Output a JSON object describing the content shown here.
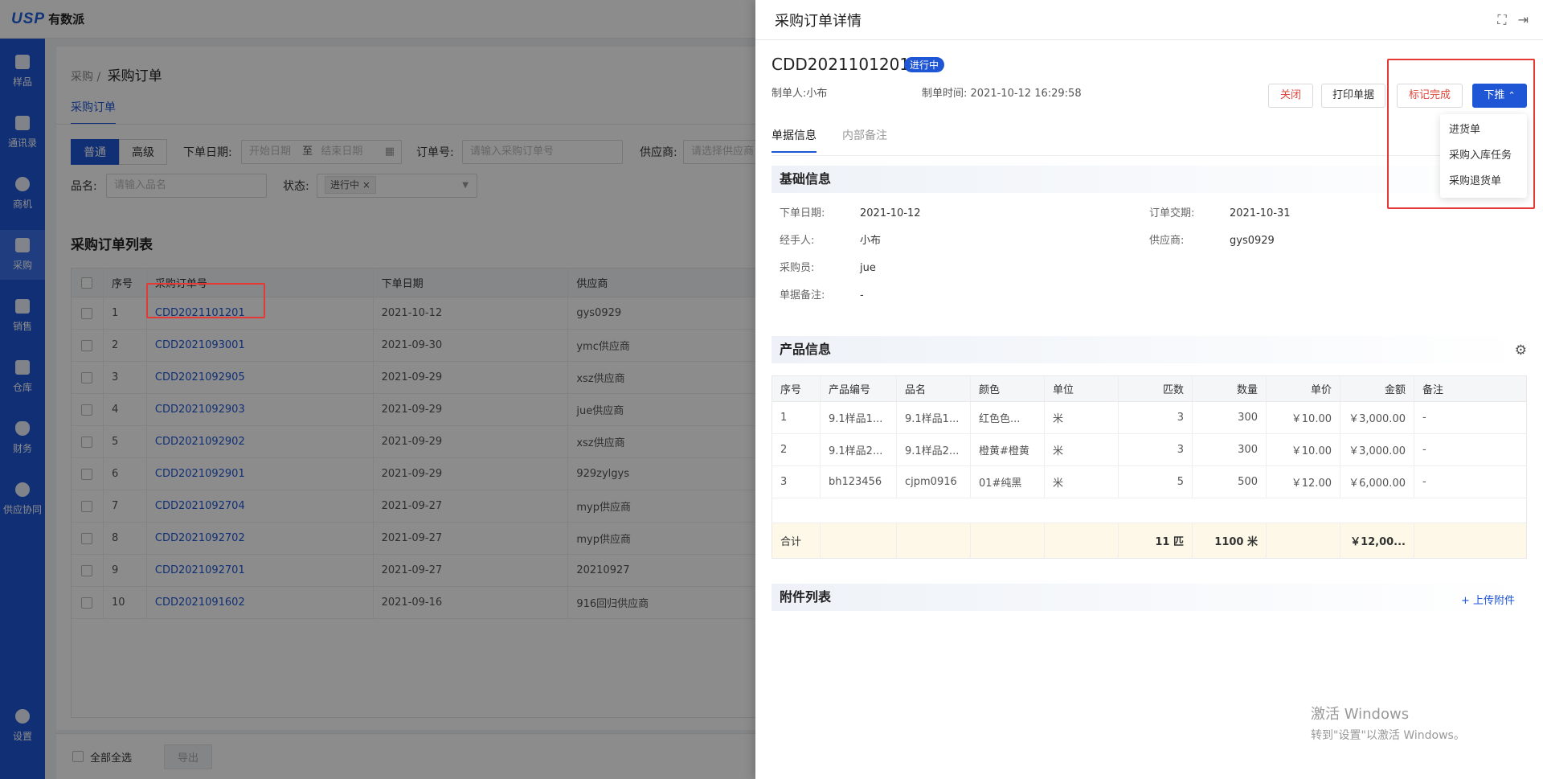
{
  "brand": {
    "mark": "USP",
    "name": "有数派",
    "accent": "#1f56d6"
  },
  "sidebar": {
    "items": [
      {
        "label": "样品",
        "icon": "sample-icon"
      },
      {
        "label": "通讯录",
        "icon": "contacts-icon"
      },
      {
        "label": "商机",
        "icon": "opportunity-icon"
      },
      {
        "label": "采购",
        "icon": "purchase-icon",
        "active": true
      },
      {
        "label": "销售",
        "icon": "sales-icon"
      },
      {
        "label": "仓库",
        "icon": "warehouse-icon"
      },
      {
        "label": "财务",
        "icon": "finance-icon"
      },
      {
        "label": "供应协同",
        "icon": "supply-icon"
      }
    ],
    "settings_label": "设置"
  },
  "page": {
    "breadcrumb_parent": "采购",
    "breadcrumb_sep": "/",
    "breadcrumb_current": "采购订单",
    "tab": "采购订单"
  },
  "filters": {
    "mode_normal": "普通",
    "mode_advanced": "高级",
    "date_label": "下单日期:",
    "date_start": "开始日期",
    "date_to": "至",
    "date_end": "结束日期",
    "order_label": "订单号:",
    "order_placeholder": "请输入采购订单号",
    "supplier_label": "供应商:",
    "supplier_placeholder": "请选择供应商",
    "product_label": "品名:",
    "product_placeholder": "请输入品名",
    "status_label": "状态:",
    "status_value": "进行中"
  },
  "list": {
    "title": "采购订单列表",
    "headers": [
      "序号",
      "采购订单号",
      "下单日期",
      "供应商"
    ],
    "rows": [
      {
        "no": "1",
        "order": "CDD2021101201",
        "date": "2021-10-12",
        "supplier": "gys0929"
      },
      {
        "no": "2",
        "order": "CDD2021093001",
        "date": "2021-09-30",
        "supplier": "ymc供应商"
      },
      {
        "no": "3",
        "order": "CDD2021092905",
        "date": "2021-09-29",
        "supplier": "xsz供应商"
      },
      {
        "no": "4",
        "order": "CDD2021092903",
        "date": "2021-09-29",
        "supplier": "jue供应商"
      },
      {
        "no": "5",
        "order": "CDD2021092902",
        "date": "2021-09-29",
        "supplier": "xsz供应商"
      },
      {
        "no": "6",
        "order": "CDD2021092901",
        "date": "2021-09-29",
        "supplier": "929zylgys"
      },
      {
        "no": "7",
        "order": "CDD2021092704",
        "date": "2021-09-27",
        "supplier": "myp供应商"
      },
      {
        "no": "8",
        "order": "CDD2021092702",
        "date": "2021-09-27",
        "supplier": "myp供应商"
      },
      {
        "no": "9",
        "order": "CDD2021092701",
        "date": "2021-09-27",
        "supplier": "20210927"
      },
      {
        "no": "10",
        "order": "CDD2021091602",
        "date": "2021-09-16",
        "supplier": "916回归供应商"
      }
    ]
  },
  "footer": {
    "select_all": "全部全选",
    "export": "导出"
  },
  "drawer": {
    "title": "采购订单详情",
    "order_no": "CDD2021101201",
    "status": "进行中",
    "creator_label": "制单人:",
    "creator": "小布",
    "created_label": "制单时间:",
    "created_at": "2021-10-12 16:29:58",
    "buttons": {
      "close": "关闭",
      "print": "打印单据",
      "mark_done": "标记完成",
      "push": "下推"
    },
    "push_menu": [
      "进货单",
      "采购入库任务",
      "采购退货单"
    ],
    "tabs": [
      "单据信息",
      "内部备注"
    ],
    "basic": {
      "title": "基础信息",
      "order_date_label": "下单日期:",
      "order_date": "2021-10-12",
      "delivery_label": "订单交期:",
      "delivery": "2021-10-31",
      "handler_label": "经手人:",
      "handler": "小布",
      "supplier_label": "供应商:",
      "supplier": "gys0929",
      "buyer_label": "采购员:",
      "buyer": "jue",
      "remark_label": "单据备注:",
      "remark": "-"
    },
    "products": {
      "title": "产品信息",
      "headers": [
        "序号",
        "产品编号",
        "品名",
        "颜色",
        "单位",
        "匹数",
        "数量",
        "单价",
        "金额",
        "备注"
      ],
      "rows": [
        {
          "no": "1",
          "code": "9.1样品1...",
          "name": "9.1样品1...",
          "color": "红色色...",
          "unit": "米",
          "pieces": "3",
          "qty": "300",
          "price": "￥10.00",
          "amount": "￥3,000.00",
          "remark": "-"
        },
        {
          "no": "2",
          "code": "9.1样品2...",
          "name": "9.1样品2...",
          "color": "橙黄#橙黄",
          "unit": "米",
          "pieces": "3",
          "qty": "300",
          "price": "￥10.00",
          "amount": "￥3,000.00",
          "remark": "-"
        },
        {
          "no": "3",
          "code": "bh123456",
          "name": "cjpm0916",
          "color": "01#纯黑",
          "unit": "米",
          "pieces": "5",
          "qty": "500",
          "price": "￥12.00",
          "amount": "￥6,000.00",
          "remark": "-"
        }
      ],
      "total_label": "合计",
      "total_pieces": "11 匹",
      "total_qty": "1100 米",
      "total_amount": "￥12,00..."
    },
    "attachments": {
      "title": "附件列表",
      "upload": "+ 上传附件"
    }
  },
  "watermark": {
    "line1": "激活 Windows",
    "line2": "转到\"设置\"以激活 Windows。"
  }
}
